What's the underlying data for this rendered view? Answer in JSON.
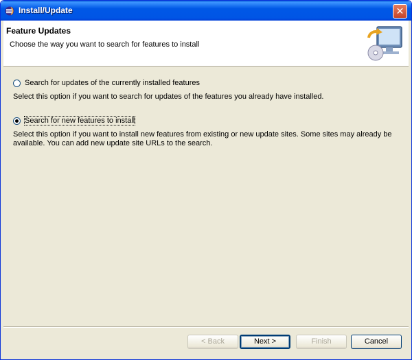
{
  "window": {
    "title": "Install/Update",
    "close_icon": "close-icon"
  },
  "header": {
    "title": "Feature Updates",
    "description": "Choose the way you want to search for features to install",
    "icon": "update-monitor-icon"
  },
  "options": [
    {
      "label": "Search for updates of the currently installed features",
      "description": "Select this option if you want to search for updates of the features you already have installed.",
      "selected": false
    },
    {
      "label": "Search for new features to install",
      "description": "Select this option if you want to install new features from existing or new update sites. Some sites may already be available. You can add new update site URLs to the search.",
      "selected": true
    }
  ],
  "buttons": {
    "back": "< Back",
    "next": "Next >",
    "finish": "Finish",
    "cancel": "Cancel"
  }
}
